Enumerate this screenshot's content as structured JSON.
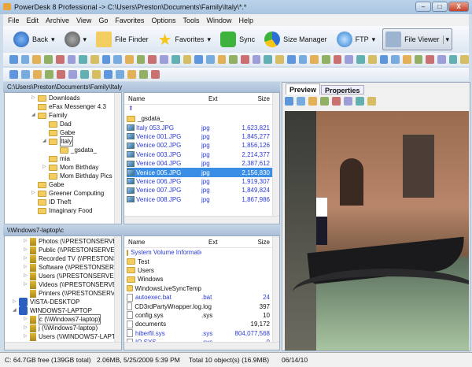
{
  "window": {
    "title": "PowerDesk 8 Professional -> C:\\Users\\Preston\\Documents\\Family\\Italy\\*.*",
    "min": "–",
    "max": "□",
    "close": "X"
  },
  "menu": [
    "File",
    "Edit",
    "Archive",
    "View",
    "Go",
    "Favorites",
    "Options",
    "Tools",
    "Window",
    "Help"
  ],
  "toolbar": {
    "back": "Back",
    "file_finder": "File Finder",
    "favorites": "Favorites",
    "sync": "Sync",
    "size_manager": "Size Manager",
    "ftp": "FTP",
    "file_viewer": "File Viewer"
  },
  "colors": {
    "accent": "#3a8ee6",
    "link": "#2b3bd6"
  },
  "top": {
    "path": "C:\\Users\\Preston\\Documents\\Family\\Italy",
    "tree": [
      {
        "label": "Downloads",
        "lvl": 0,
        "exp": "▷"
      },
      {
        "label": "eFax Messenger 4.3",
        "lvl": 0,
        "exp": ""
      },
      {
        "label": "Family",
        "lvl": 0,
        "exp": "◢"
      },
      {
        "label": "Dad",
        "lvl": 1,
        "exp": ""
      },
      {
        "label": "Gabe",
        "lvl": 1,
        "exp": ""
      },
      {
        "label": "Italy",
        "lvl": 1,
        "exp": "◢"
      },
      {
        "label": "_gsdata_",
        "lvl": 2,
        "exp": ""
      },
      {
        "label": "mia",
        "lvl": 1,
        "exp": ""
      },
      {
        "label": "Mom Birthday",
        "lvl": 1,
        "exp": "▷"
      },
      {
        "label": "Mom Birthday Pics",
        "lvl": 1,
        "exp": ""
      },
      {
        "label": "Gabe",
        "lvl": 0,
        "exp": ""
      },
      {
        "label": "Greener Computing",
        "lvl": 0,
        "exp": "▷"
      },
      {
        "label": "ID Theft",
        "lvl": 0,
        "exp": ""
      },
      {
        "label": "Imaginary Food",
        "lvl": 0,
        "exp": ""
      }
    ],
    "headers": {
      "name": "Name",
      "ext": "Ext",
      "size": "Size"
    },
    "files": [
      {
        "name": "_gsdata_",
        "ext": "",
        "size": "",
        "type": "folder"
      },
      {
        "name": "Italy 053.JPG",
        "ext": "jpg",
        "size": "1,623,821",
        "type": "img"
      },
      {
        "name": "Venice 001.JPG",
        "ext": "jpg",
        "size": "1,845,277",
        "type": "img"
      },
      {
        "name": "Venice 002.JPG",
        "ext": "jpg",
        "size": "1,856,126",
        "type": "img"
      },
      {
        "name": "Venice 003.JPG",
        "ext": "jpg",
        "size": "2,214,377",
        "type": "img"
      },
      {
        "name": "Venice 004.JPG",
        "ext": "jpg",
        "size": "2,387,612",
        "type": "img"
      },
      {
        "name": "Venice 005.JPG",
        "ext": "jpg",
        "size": "2,156,830",
        "type": "img",
        "selected": true
      },
      {
        "name": "Venice 006.JPG",
        "ext": "jpg",
        "size": "1,919,307",
        "type": "img"
      },
      {
        "name": "Venice 007.JPG",
        "ext": "jpg",
        "size": "1,849,824",
        "type": "img"
      },
      {
        "name": "Venice 008.JPG",
        "ext": "jpg",
        "size": "1,867,986",
        "type": "img"
      }
    ]
  },
  "bottom": {
    "path": "\\\\Windows7-laptop\\c",
    "tree": [
      {
        "label": "Photos (\\\\PRESTONSERVE",
        "lvl": 1,
        "exp": "▷",
        "t": "drv"
      },
      {
        "label": "Public (\\\\PRESTONSERVEF",
        "lvl": 1,
        "exp": "▷",
        "t": "drv"
      },
      {
        "label": "Recorded TV (\\\\PRESTONS",
        "lvl": 1,
        "exp": "▷",
        "t": "drv"
      },
      {
        "label": "Software (\\\\PRESTONSERV",
        "lvl": 1,
        "exp": "▷",
        "t": "drv"
      },
      {
        "label": "Users (\\\\PRESTONSERVEF",
        "lvl": 1,
        "exp": "▷",
        "t": "drv"
      },
      {
        "label": "Videos (\\\\PRESTONSERVE",
        "lvl": 1,
        "exp": "▷",
        "t": "drv"
      },
      {
        "label": "Printers (\\\\PRESTONSERVE",
        "lvl": 1,
        "exp": "",
        "t": "drv"
      },
      {
        "label": "VISTA-DESKTOP",
        "lvl": 0,
        "exp": "▷",
        "t": "pc"
      },
      {
        "label": "WINDOWS7-LAPTOP",
        "lvl": 0,
        "exp": "◢",
        "t": "pc"
      },
      {
        "label": "c (\\\\Windows7-laptop)",
        "lvl": 1,
        "exp": "▷",
        "t": "drv"
      },
      {
        "label": "j (\\\\Windows7-laptop)",
        "lvl": 1,
        "exp": "▷",
        "t": "drv"
      },
      {
        "label": "Users (\\\\WINDOWS7-LAPT(",
        "lvl": 1,
        "exp": "▷",
        "t": "drv"
      },
      {
        "label": "Printers (\\\\WINDOWS7-LAP",
        "lvl": 1,
        "exp": "",
        "t": "drv"
      }
    ],
    "files": [
      {
        "name": "System Volume Information",
        "ext": "",
        "size": "",
        "type": "folder",
        "blue": true
      },
      {
        "name": "Test",
        "ext": "",
        "size": "",
        "type": "folder"
      },
      {
        "name": "Users",
        "ext": "",
        "size": "",
        "type": "folder"
      },
      {
        "name": "Windows",
        "ext": "",
        "size": "",
        "type": "folder"
      },
      {
        "name": "WindowsLiveSyncTemp",
        "ext": "",
        "size": "",
        "type": "folder"
      },
      {
        "name": "autoexec.bat",
        "ext": ".bat",
        "size": "24",
        "type": "doc",
        "blue": true
      },
      {
        "name": "CD3rdPartyWrapper.log",
        "ext": ".log",
        "size": "397",
        "type": "doc"
      },
      {
        "name": "config.sys",
        "ext": ".sys",
        "size": "10",
        "type": "doc"
      },
      {
        "name": "documents",
        "ext": "",
        "size": "19,172",
        "type": "doc"
      },
      {
        "name": "hiberfil.sys",
        "ext": ".sys",
        "size": "804,077,568",
        "type": "doc",
        "blue": true
      },
      {
        "name": "IO.SYS",
        "ext": ".sys",
        "size": "0",
        "type": "doc",
        "blue": true
      }
    ]
  },
  "preview": {
    "tabs": [
      "Preview",
      "Properties"
    ],
    "active": "Preview"
  },
  "status": {
    "free": "C: 64.7GB free (139GB total)",
    "info": "2.06MB,  5/25/2009  5:39 PM",
    "total": "Total 10 object(s) (16.9MB)",
    "date": "06/14/10"
  }
}
